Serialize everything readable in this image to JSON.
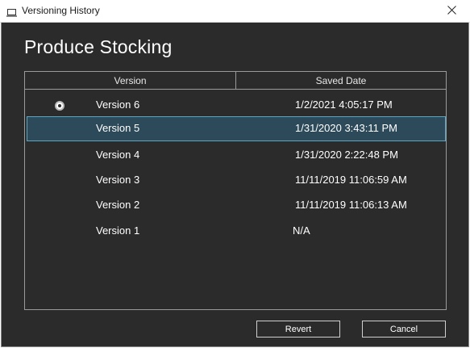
{
  "window": {
    "title": "Versioning History",
    "close_glyph": "✕"
  },
  "dialog": {
    "heading": "Produce Stocking",
    "columns": {
      "version": "Version",
      "saved_date": "Saved Date"
    },
    "rows": [
      {
        "version": "Version 6",
        "saved_date": "1/2/2021 4:05:17 PM",
        "current": true,
        "selected": false
      },
      {
        "version": "Version 5",
        "saved_date": "1/31/2020 3:43:11 PM",
        "current": false,
        "selected": true
      },
      {
        "version": "Version 4",
        "saved_date": "1/31/2020 2:22:48 PM",
        "current": false,
        "selected": false
      },
      {
        "version": "Version 3",
        "saved_date": "11/11/2019 11:06:59 AM",
        "current": false,
        "selected": false
      },
      {
        "version": "Version 2",
        "saved_date": "11/11/2019 11:06:13 AM",
        "current": false,
        "selected": false
      },
      {
        "version": "Version 1",
        "saved_date": "N/A",
        "current": false,
        "selected": false
      }
    ],
    "buttons": {
      "revert": "Revert",
      "cancel": "Cancel"
    }
  },
  "colors": {
    "dialog_bg": "#2b2b2b",
    "selected_bg": "#2c4a59",
    "selected_border": "#5aa5c2"
  }
}
